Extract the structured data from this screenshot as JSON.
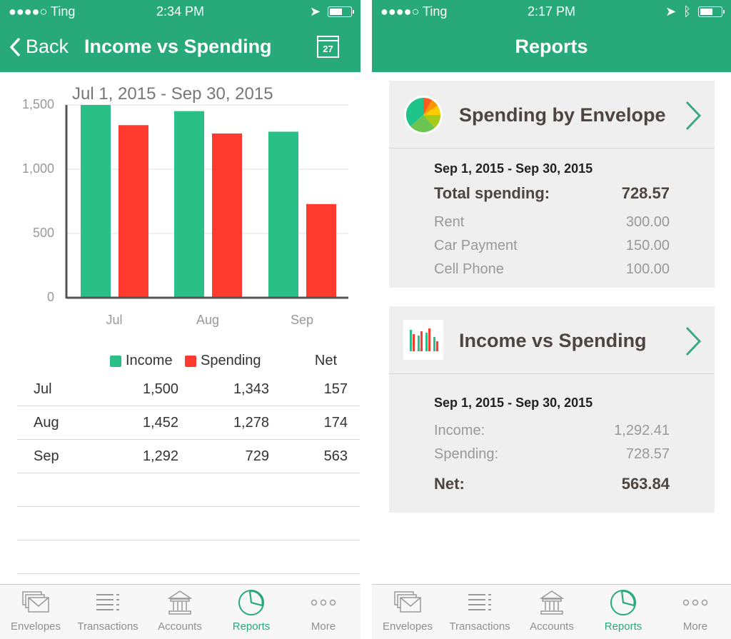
{
  "left": {
    "status": {
      "carrier": "●●●●○ Ting",
      "time": "2:34 PM"
    },
    "nav": {
      "back": "Back",
      "title": "Income vs Spending",
      "calendar_day": "27"
    },
    "chart_data": {
      "type": "bar",
      "title": "Jul 1, 2015 - Sep 30, 2015",
      "categories": [
        "Jul",
        "Aug",
        "Sep"
      ],
      "series": [
        {
          "name": "Income",
          "values": [
            1500,
            1452,
            1292
          ],
          "color": "#2bbf88"
        },
        {
          "name": "Spending",
          "values": [
            1343,
            1278,
            729
          ],
          "color": "#ff3b30"
        }
      ],
      "ylim": [
        0,
        1500
      ],
      "yticks": [
        "0",
        "500",
        "1,000",
        "1,500"
      ],
      "grid": true
    },
    "table": {
      "headers": {
        "income": "Income",
        "spending": "Spending",
        "net": "Net"
      },
      "rows": [
        {
          "label": "Jul",
          "income": "1,500",
          "spending": "1,343",
          "net": "157"
        },
        {
          "label": "Aug",
          "income": "1,452",
          "spending": "1,278",
          "net": "174"
        },
        {
          "label": "Sep",
          "income": "1,292",
          "spending": "729",
          "net": "563"
        }
      ]
    }
  },
  "right": {
    "status": {
      "carrier": "●●●●○ Ting",
      "time": "2:17 PM"
    },
    "nav": {
      "title": "Reports"
    },
    "cards": [
      {
        "title": "Spending by Envelope",
        "date": "Sep 1, 2015 - Sep 30, 2015",
        "total_label": "Total spending:",
        "total_value": "728.57",
        "rows": [
          {
            "label": "Rent",
            "value": "300.00"
          },
          {
            "label": "Car Payment",
            "value": "150.00"
          },
          {
            "label": "Cell Phone",
            "value": "100.00"
          }
        ]
      },
      {
        "title": "Income vs Spending",
        "date": "Sep 1, 2015 - Sep 30, 2015",
        "rows": [
          {
            "label": "Income:",
            "value": "1,292.41"
          },
          {
            "label": "Spending:",
            "value": "728.57"
          }
        ],
        "net_label": "Net:",
        "net_value": "563.84"
      }
    ]
  },
  "tabs": [
    {
      "label": "Envelopes",
      "icon": "envelopes-icon"
    },
    {
      "label": "Transactions",
      "icon": "list-icon"
    },
    {
      "label": "Accounts",
      "icon": "bank-icon"
    },
    {
      "label": "Reports",
      "icon": "pie-chart-icon",
      "active": true
    },
    {
      "label": "More",
      "icon": "more-icon"
    }
  ],
  "colors": {
    "brand": "#27a97a",
    "income": "#2bbf88",
    "spending": "#ff3b30"
  }
}
